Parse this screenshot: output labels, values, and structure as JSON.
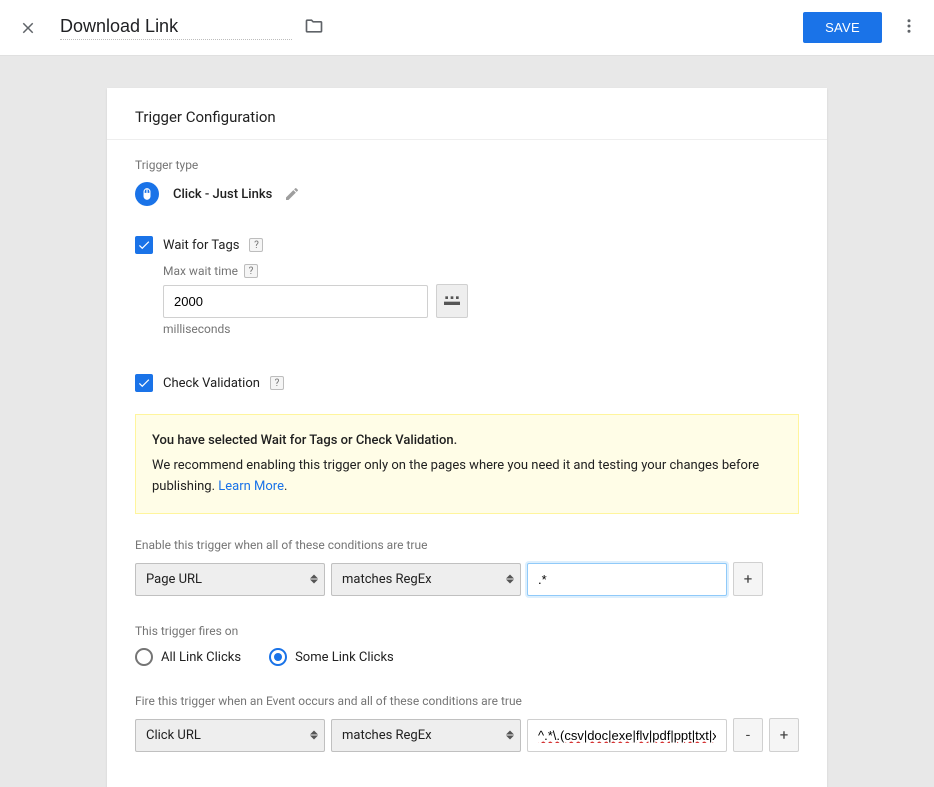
{
  "header": {
    "title": "Download Link",
    "save_label": "SAVE"
  },
  "panel": {
    "title": "Trigger Configuration",
    "type_label": "Trigger type",
    "type_value": "Click - Just Links",
    "wait_for_tags_label": "Wait for Tags",
    "max_wait_label": "Max wait time",
    "max_wait_value": "2000",
    "units": "milliseconds",
    "check_validation_label": "Check Validation",
    "warning": {
      "bold": "You have selected Wait for Tags or Check Validation.",
      "body": "We recommend enabling this trigger only on the pages where you need it and testing your changes before publishing. ",
      "link": "Learn More"
    },
    "enable_label": "Enable this trigger when all of these conditions are true",
    "cond1": {
      "field": "Page URL",
      "op": "matches RegEx",
      "value": ".*"
    },
    "fires_label": "This trigger fires on",
    "radio_all": "All Link Clicks",
    "radio_some": "Some Link Clicks",
    "fire_when_label": "Fire this trigger when an Event occurs and all of these conditions are true",
    "cond2": {
      "field": "Click URL",
      "op": "matches RegEx",
      "value": "^.*\\.(csv|doc|exe|flv|pdf|ppt|txt|xls)$"
    }
  }
}
